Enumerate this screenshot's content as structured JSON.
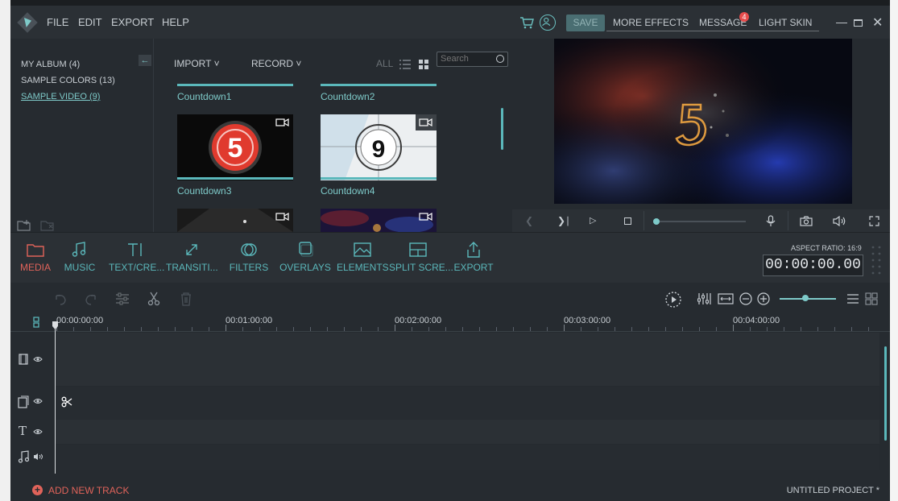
{
  "menu": [
    "FILE",
    "EDIT",
    "EXPORT",
    "HELP"
  ],
  "titlebar": {
    "save_label": "SAVE",
    "more_effects": "MORE EFFECTS",
    "message": "MESSAGE",
    "message_badge": "4",
    "light_skin": "LIGHT SKIN"
  },
  "albums": [
    {
      "label": "MY ALBUM (4)"
    },
    {
      "label": "SAMPLE COLORS (13)"
    },
    {
      "label": "SAMPLE VIDEO (9)"
    }
  ],
  "library": {
    "import_label": "IMPORT",
    "record_label": "RECORD",
    "all_label": "ALL",
    "search_placeholder": "Search",
    "items": [
      {
        "label": "Countdown1"
      },
      {
        "label": "Countdown2"
      },
      {
        "label": "Countdown3",
        "digit": "5"
      },
      {
        "label": "Countdown4",
        "digit": "9"
      }
    ]
  },
  "tools": [
    {
      "label": "MEDIA"
    },
    {
      "label": "MUSIC"
    },
    {
      "label": "TEXT/CRE..."
    },
    {
      "label": "TRANSITI..."
    },
    {
      "label": "FILTERS"
    },
    {
      "label": "OVERLAYS"
    },
    {
      "label": "ELEMENTS"
    },
    {
      "label": "SPLIT SCRE..."
    },
    {
      "label": "EXPORT"
    }
  ],
  "aspect_ratio": "ASPECT RATIO: 16:9",
  "timecode": "00:00:00.00",
  "ruler": [
    "00:00:00:00",
    "00:01:00:00",
    "00:02:00:00",
    "00:03:00:00",
    "00:04:00:00"
  ],
  "bottom": {
    "add_track": "ADD NEW TRACK",
    "project_name": "UNTITLED PROJECT *"
  },
  "colors": {
    "accent": "#5bb8bb",
    "active": "#e0635a",
    "background": "#262b30"
  }
}
